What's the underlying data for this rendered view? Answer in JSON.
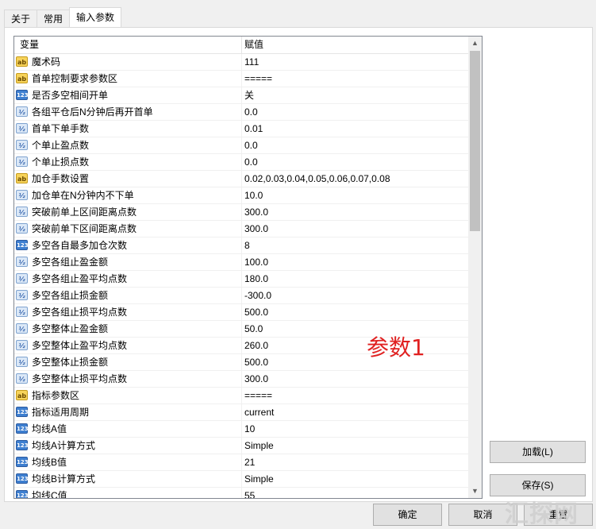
{
  "tabs": [
    "关于",
    "常用",
    "输入参数"
  ],
  "grid": {
    "header_variable": "变量",
    "header_value": "赋值",
    "rows": [
      {
        "icon": "ab",
        "name": "魔术码",
        "value": "111"
      },
      {
        "icon": "ab",
        "name": "首单控制要求参数区",
        "value": "====="
      },
      {
        "icon": "123",
        "name": "是否多空相间开单",
        "value": "关"
      },
      {
        "icon": "v2",
        "name": "各组平仓后N分钟后再开首单",
        "value": "0.0"
      },
      {
        "icon": "v2",
        "name": "首单下单手数",
        "value": "0.01"
      },
      {
        "icon": "v2",
        "name": "个单止盈点数",
        "value": "0.0"
      },
      {
        "icon": "v2",
        "name": "个单止损点数",
        "value": "0.0"
      },
      {
        "icon": "ab",
        "name": "加仓手数设置",
        "value": "0.02,0.03,0.04,0.05,0.06,0.07,0.08"
      },
      {
        "icon": "v2",
        "name": "加仓单在N分钟内不下单",
        "value": "10.0"
      },
      {
        "icon": "v2",
        "name": "突破前单上区间距离点数",
        "value": "300.0"
      },
      {
        "icon": "v2",
        "name": "突破前单下区间距离点数",
        "value": "300.0"
      },
      {
        "icon": "123",
        "name": "多空各自最多加仓次数",
        "value": "8"
      },
      {
        "icon": "v2",
        "name": "多空各组止盈金额",
        "value": "100.0"
      },
      {
        "icon": "v2",
        "name": "多空各组止盈平均点数",
        "value": "180.0"
      },
      {
        "icon": "v2",
        "name": "多空各组止损金额",
        "value": "-300.0"
      },
      {
        "icon": "v2",
        "name": "多空各组止损平均点数",
        "value": "500.0"
      },
      {
        "icon": "v2",
        "name": "多空整体止盈金额",
        "value": "50.0"
      },
      {
        "icon": "v2",
        "name": "多空整体止盈平均点数",
        "value": "260.0"
      },
      {
        "icon": "v2",
        "name": "多空整体止损金额",
        "value": "500.0"
      },
      {
        "icon": "v2",
        "name": "多空整体止损平均点数",
        "value": "300.0"
      },
      {
        "icon": "ab",
        "name": "指标参数区",
        "value": "====="
      },
      {
        "icon": "123",
        "name": "指标适用周期",
        "value": "current"
      },
      {
        "icon": "123",
        "name": "均线A值",
        "value": "10"
      },
      {
        "icon": "123",
        "name": "均线A计算方式",
        "value": "Simple"
      },
      {
        "icon": "123",
        "name": "均线B值",
        "value": "21"
      },
      {
        "icon": "123",
        "name": "均线B计算方式",
        "value": "Simple"
      },
      {
        "icon": "123",
        "name": "均线C值",
        "value": "55"
      }
    ]
  },
  "annotation": "参数1",
  "buttons": {
    "load": "加载(L)",
    "save": "保存(S)",
    "ok": "确定",
    "cancel": "取消",
    "reset": "重置"
  },
  "corner_watermark": "汇探网"
}
